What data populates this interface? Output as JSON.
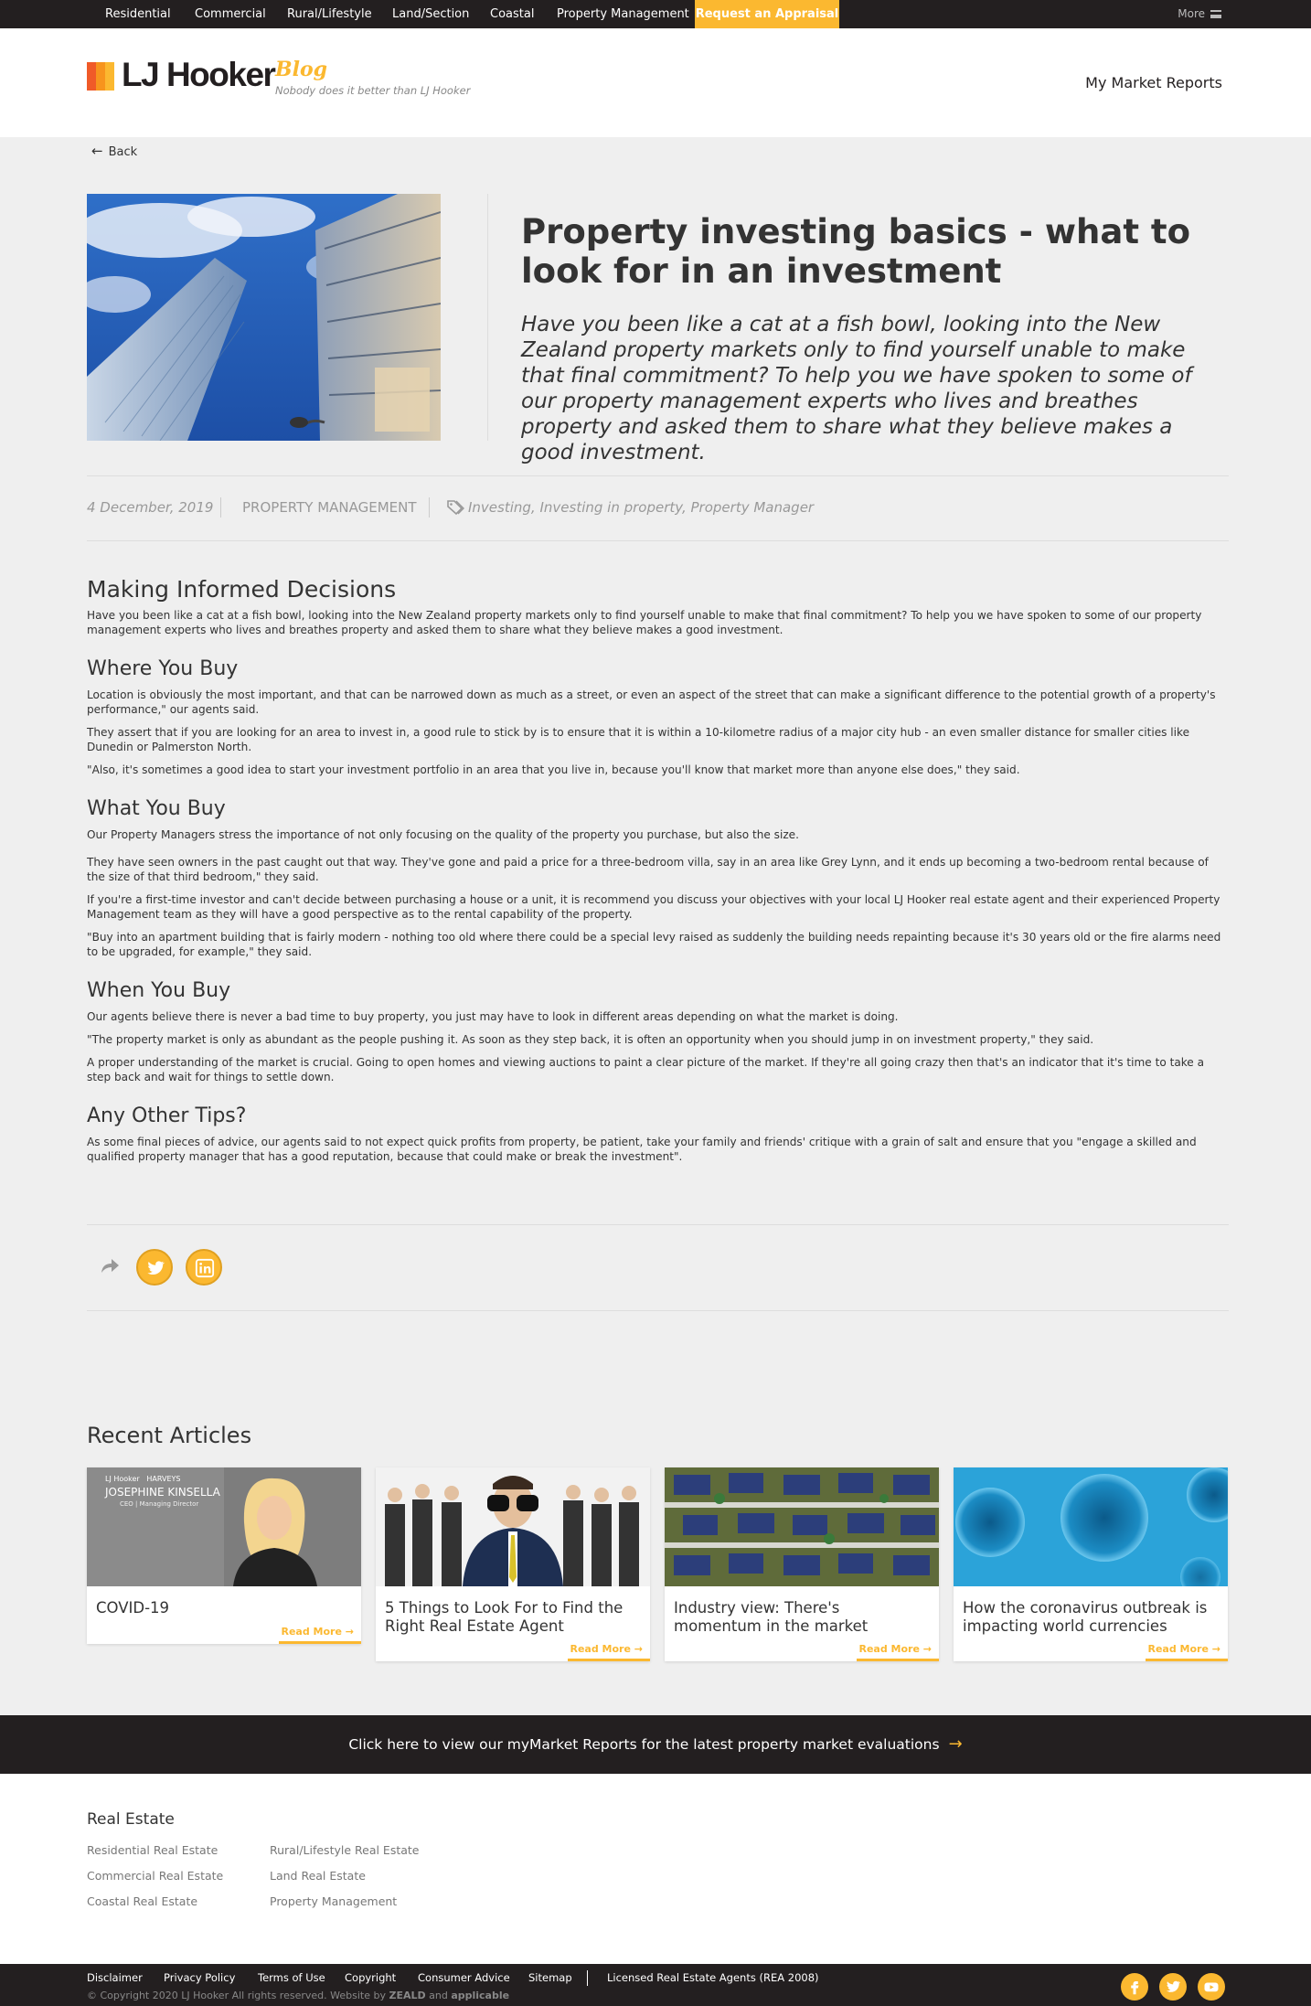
{
  "topnav": {
    "items": [
      "Residential",
      "Commercial",
      "Rural/Lifestyle",
      "Land/Section",
      "Coastal",
      "Property Management"
    ],
    "appraisal": "Request an Appraisal",
    "more": "More"
  },
  "header": {
    "logo": "LJ Hooker",
    "blog": "Blog",
    "tagline": "Nobody does it better than LJ Hooker",
    "market_reports": "My Market Reports"
  },
  "back": "Back",
  "article": {
    "title": "Property investing basics - what to look for in an investment",
    "intro": "Have you been like a cat at a fish bowl, looking into the New Zealand property markets only to find yourself unable to make that final commitment?  To help you we have spoken to some of our property management experts who lives and breathes property and asked them to share what they believe makes a good investment.",
    "date": "4 December, 2019",
    "category": "PROPERTY MANAGEMENT",
    "tags": "Investing, Investing in property, Property Manager",
    "heading": "Making Informed Decisions",
    "p_intro": "Have you been like a cat at a fish bowl, looking into the New Zealand property markets only to find yourself unable to make that final commitment?  To help you we have spoken to some of our property management experts who lives and breathes property and asked them to share what they believe makes a good investment.",
    "s1_title": "Where You Buy",
    "s1_p1": "Location is obviously the most important, and that can be narrowed down as much as a street, or even an aspect of the street that can make a significant difference to the potential growth of a property's performance,\" our agents said.",
    "s1_p2": "They assert that if you are looking for an area to invest in, a good rule to stick by is to ensure that it is within a 10-kilometre radius of a major city hub - an even smaller distance for smaller cities like Dunedin or Palmerston North.",
    "s1_p3": "\"Also, it's sometimes a good idea to start your investment portfolio in an area that you live in, because you'll know that market more than anyone else does,\" they said.",
    "s2_title": "What You Buy",
    "s2_p1": "Our Property Managers stress the importance of not only focusing on the quality of the property you purchase, but also the size.",
    "s2_p2": "They have seen owners in the past caught out that way. They've gone and paid a price for a three-bedroom villa, say in an area like Grey Lynn, and it ends up becoming a two-bedroom rental because of the size of that third bedroom,\" they said.",
    "s2_p3": "If you're a first-time investor and can't decide between purchasing a house or a unit, it is recommend you discuss your objectives with your local LJ Hooker real estate agent and their experienced Property Management team as they will have a good perspective as to the rental capability of the property.",
    "s2_p4": "\"Buy into an apartment building that is fairly modern - nothing too old where there could be a special levy raised as suddenly the building needs repainting because it's 30 years old or the fire alarms need to be upgraded, for example,\" they said.",
    "s3_title": "When You Buy",
    "s3_p1": "Our agents believe there is never a bad time to buy property, you just may have to look in different areas depending on what the market is doing.",
    "s3_p2": "\"The property market is only as abundant as the people pushing it. As soon as they step back, it is often an opportunity when you should jump in on investment property,\" they said.",
    "s3_p3": "A proper understanding of the market is crucial.  Going to open homes and viewing auctions to paint a clear picture of the market.  If they're all going crazy then that's an indicator that it's time to take a step back and wait for things to settle down.",
    "s4_title": "Any Other Tips?",
    "s4_p1": "As some final pieces of advice, our agents said to not expect quick profits from property, be patient, take your family and friends' critique with a grain of salt and ensure that you \"engage a skilled and qualified property manager that has a good reputation, because that could make or break the investment\"."
  },
  "recent": {
    "title": "Recent Articles",
    "cards": [
      {
        "title": "COVID-19",
        "read_more": "Read More",
        "img_caption": "JOSEPHINE KINSELLA",
        "img_sub": "CEO | Managing Director",
        "img_brand": "LJ Hooker",
        "img_brand2": "HARVEYS"
      },
      {
        "title": "5 Things to Look For to Find the Right Real Estate Agent",
        "read_more": "Read More"
      },
      {
        "title": "Industry view: There's momentum in the market",
        "read_more": "Read More"
      },
      {
        "title": "How the coronavirus outbreak is impacting world currencies",
        "read_more": "Read More"
      }
    ]
  },
  "cta": "Click here to view our myMarket Reports for the latest property market evaluations",
  "footer": {
    "heading": "Real Estate",
    "col1": [
      "Residential Real Estate",
      "Commercial Real Estate",
      "Coastal Real Estate"
    ],
    "col2": [
      "Rural/Lifestyle Real Estate",
      "Land Real Estate",
      "Property Management"
    ]
  },
  "bottombar": {
    "links": [
      "Disclaimer",
      "Privacy Policy",
      "Terms of Use",
      "Copyright",
      "Consumer Advice",
      "Sitemap"
    ],
    "licensed": "Licensed Real Estate Agents (REA 2008)",
    "copyright": "© Copyright 2020 LJ Hooker All rights reserved. Website by",
    "credit1": "ZEALD",
    "credit_and": "and",
    "credit2": "applicable"
  },
  "colors": {
    "accent": "#fbb830",
    "dark": "#231f20"
  }
}
